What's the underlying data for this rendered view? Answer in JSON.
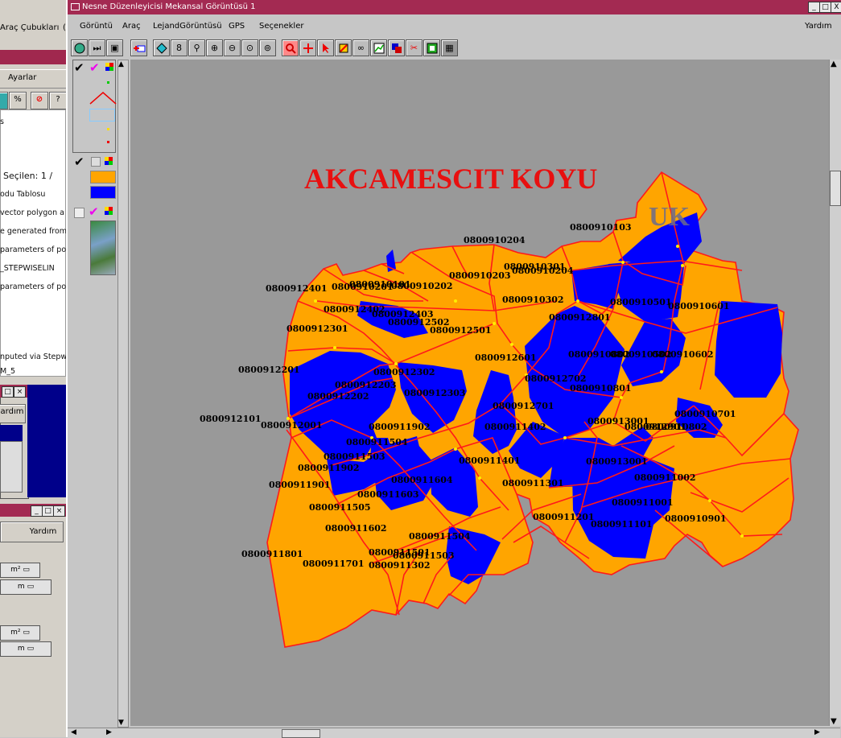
{
  "background_window": {
    "menu_item": "Araç Çubukları",
    "menu_item2": "(",
    "tab_label": "Ayarlar",
    "lines": [
      "s",
      "Seçilen: 1 /",
      "odu Tablosu",
      "vector polygon a",
      "e generated from",
      "parameters of po",
      "_STEPWISELIN",
      "parameters of po",
      "nputed via Stepw",
      "M_5"
    ],
    "help_button_1": "ardım",
    "help_button_2": "Yardım",
    "unit_area_1": "m²",
    "unit_len_1": "m",
    "unit_area_2": "m²",
    "unit_len_2": "m"
  },
  "window": {
    "title": "Nesne Düzenleyicisi Mekansal Görüntüsü 1",
    "controls": [
      "_",
      "□",
      "X"
    ]
  },
  "menu": {
    "items": [
      "Görüntü",
      "Araç",
      "LejandGörüntüsü",
      "GPS",
      "Seçenekler"
    ],
    "help": "Yardım"
  },
  "toolbar": {
    "icons": [
      "globe-icon",
      "fast-forward-icon",
      "frame-icon",
      "add-layer-icon",
      "diamond-icon",
      "binoculars-icon",
      "find-icon",
      "zoom-in-icon",
      "zoom-out-icon",
      "zoom-fit-icon",
      "zoom-box-icon",
      "zoom-red-icon",
      "crosshair-icon",
      "pointer-icon",
      "edit-icon",
      "link-icon",
      "chart-icon",
      "layers-icon",
      "scissors-icon",
      "export-icon",
      "grid-icon"
    ]
  },
  "map": {
    "title": "AKCAMESCIT KOYU",
    "overlay_text": "UK",
    "colors": {
      "parcel_fill": "#ffa500",
      "parcel_stroke": "#ff1a1a",
      "raster_blue": "#0000ff",
      "background": "#999999",
      "highlight": "#ff33ff"
    },
    "highlighted": "0800912702",
    "labels": [
      "0800910204",
      "0800910103",
      "0800910301",
      "0800910203",
      "0800910204",
      "0800910101",
      "0800910201",
      "0800910202",
      "0800912401",
      "0800910302",
      "0800910501",
      "0800910601",
      "0800912402",
      "0800912403",
      "0800912801",
      "0800912502",
      "0800912301",
      "0800912501",
      "0800910502",
      "0800910602",
      "0800912601",
      "0800910802",
      "0800912201",
      "0800912302",
      "0800912702",
      "0800910801",
      "0800912203",
      "0800912303",
      "0800912202",
      "0800912701",
      "0800910701",
      "0800912101",
      "0800913001",
      "0800912001",
      "0800911902",
      "0800911402",
      "0800912901",
      "0800910802",
      "0800911504",
      "0800911503",
      "0800913001",
      "0800911401",
      "0800911902",
      "0800911604",
      "0800911002",
      "0800911901",
      "0800911301",
      "0800911603",
      "0800911001",
      "0800911505",
      "0800910901",
      "0800911602",
      "0800911201",
      "0800911101",
      "0800911504",
      "0800911801",
      "0800911701",
      "0800911302",
      "0800911501",
      "0800911503"
    ]
  }
}
